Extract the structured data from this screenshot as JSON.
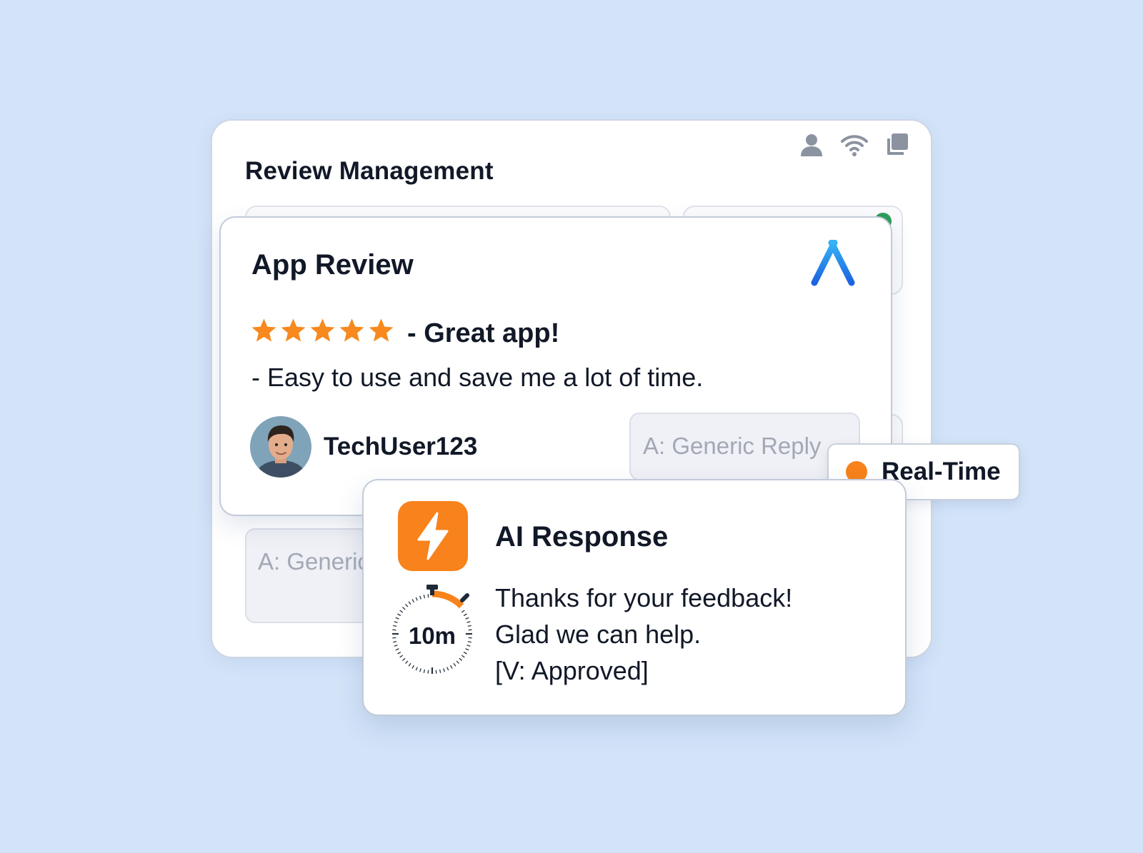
{
  "window": {
    "title": "Review Management",
    "header_icons": [
      "user-icon",
      "wifi-icon",
      "copy-icon"
    ],
    "background_reply": "A: Generic"
  },
  "review": {
    "title": "App Review",
    "platform_icon": "app-store-icon",
    "rating": 5,
    "rating_max": 5,
    "headline": "- Great app!",
    "body": "- Easy to use and save me a lot of time.",
    "username": "TechUser123",
    "reply_placeholder": "A: Generic Reply"
  },
  "status_pill": {
    "label": "Real-Time",
    "dot_color": "#f8821b"
  },
  "ai_response": {
    "title": "AI Response",
    "icon": "lightning-bolt-icon",
    "timer_label": "10m",
    "lines": [
      "Thanks for your feedback!",
      "Glad we can help.",
      "[V: Approved]"
    ]
  },
  "colors": {
    "background": "#d3e4f9",
    "accent_orange": "#f8821b",
    "star": "#f7891e",
    "app_store_blue": "#1f7ae8"
  }
}
